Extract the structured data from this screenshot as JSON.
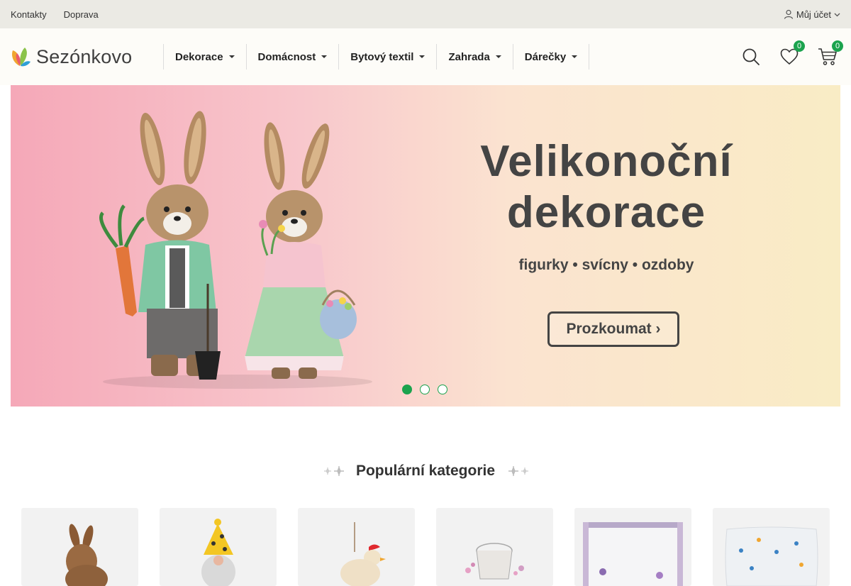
{
  "topbar": {
    "links": [
      "Kontakty",
      "Doprava"
    ],
    "account_label": "Můj účet"
  },
  "header": {
    "logo_text": "Sezónkovo",
    "nav": [
      "Dekorace",
      "Domácnost",
      "Bytový textil",
      "Zahrada",
      "Dárečky"
    ],
    "wishlist_count": "0",
    "cart_count": "0",
    "icons": [
      "search-icon",
      "heart-icon",
      "cart-icon",
      "user-icon"
    ]
  },
  "hero": {
    "title_line1": "Velikonoční",
    "title_line2": "dekorace",
    "subtitle": "figurky • svícny • ozdoby",
    "cta": "Prozkoumat ›",
    "slides": 3,
    "active_slide": 1
  },
  "section": {
    "title": "Populární kategorie"
  },
  "colors": {
    "accent": "#1ba34e",
    "topbar_bg": "#ebeae4",
    "header_bg": "#fdfcf8"
  }
}
